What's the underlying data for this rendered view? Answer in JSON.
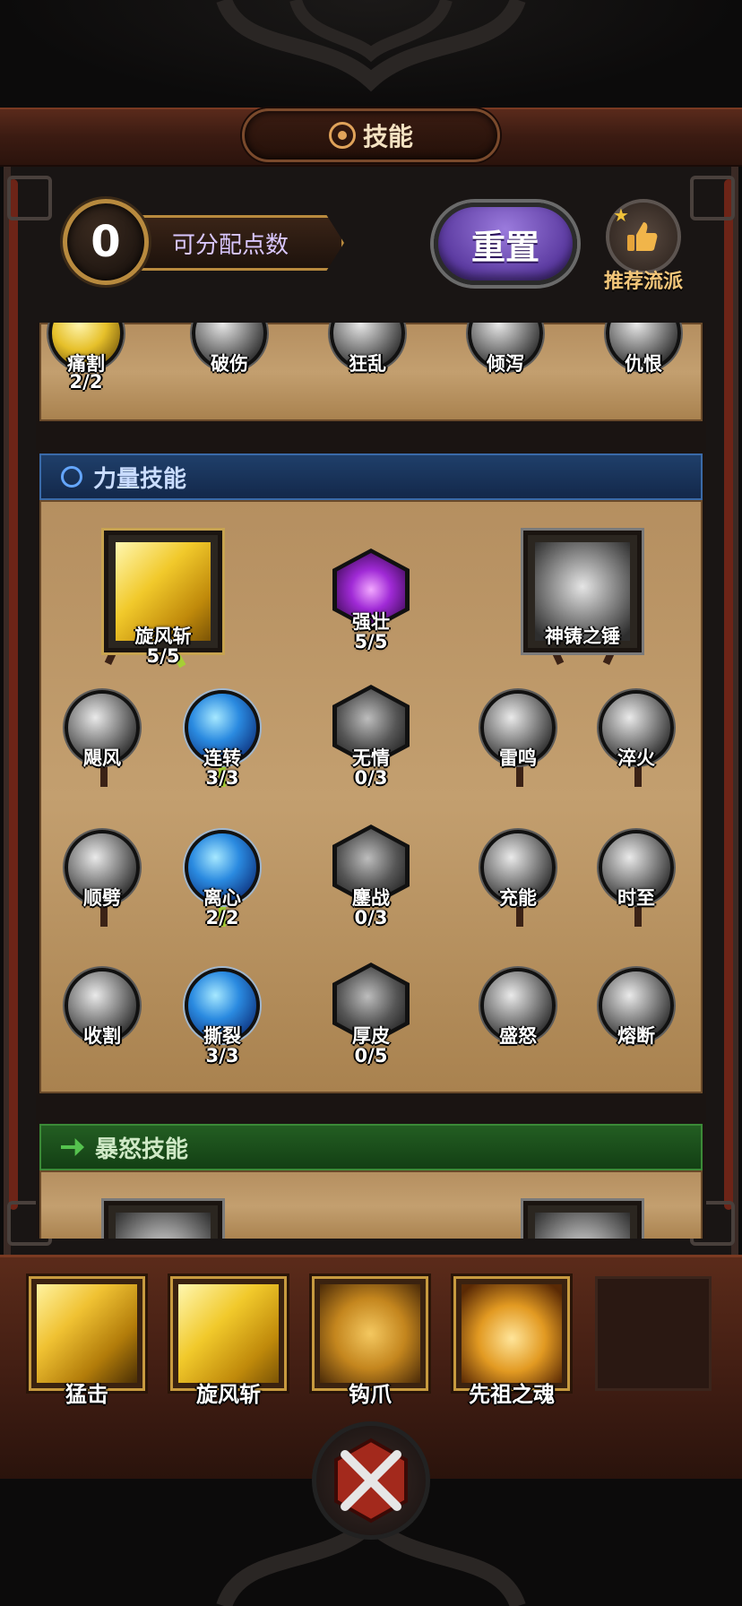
{
  "title": "技能",
  "header": {
    "points_value": "0",
    "points_label": "可分配点数",
    "reset_label": "重置",
    "recommend_label": "推荐流派"
  },
  "top_row": [
    {
      "name": "痛割",
      "level": "2/2"
    },
    {
      "name": "破伤",
      "level": ""
    },
    {
      "name": "狂乱",
      "level": ""
    },
    {
      "name": "倾泻",
      "level": ""
    },
    {
      "name": "仇恨",
      "level": ""
    }
  ],
  "strength_section": {
    "title": "力量技能",
    "main_left": {
      "name": "旋风斩",
      "level": "5/5"
    },
    "main_center": {
      "name": "强壮",
      "level": "5/5"
    },
    "main_right": {
      "name": "神铸之锤",
      "level": ""
    },
    "col1": [
      {
        "name": "飓风",
        "level": ""
      },
      {
        "name": "顺劈",
        "level": ""
      },
      {
        "name": "收割",
        "level": ""
      }
    ],
    "col2": [
      {
        "name": "连转",
        "level": "3/3"
      },
      {
        "name": "离心",
        "level": "2/2"
      },
      {
        "name": "撕裂",
        "level": "3/3"
      }
    ],
    "col3": [
      {
        "name": "无情",
        "level": "0/3"
      },
      {
        "name": "鏖战",
        "level": "0/3"
      },
      {
        "name": "厚皮",
        "level": "0/5"
      }
    ],
    "col4": [
      {
        "name": "雷鸣",
        "level": ""
      },
      {
        "name": "充能",
        "level": ""
      },
      {
        "name": "盛怒",
        "level": ""
      }
    ],
    "col5": [
      {
        "name": "淬火",
        "level": ""
      },
      {
        "name": "时至",
        "level": ""
      },
      {
        "name": "熔断",
        "level": ""
      }
    ]
  },
  "rage_section": {
    "title": "暴怒技能"
  },
  "hotbar": [
    {
      "name": "猛击"
    },
    {
      "name": "旋风斩"
    },
    {
      "name": "钩爪"
    },
    {
      "name": "先祖之魂"
    }
  ],
  "colors": {
    "accent_gold": "#c79a3f",
    "reset_purple": "#6a46b5",
    "strength_blue": "#1f3f6a",
    "rage_green": "#235e22"
  }
}
